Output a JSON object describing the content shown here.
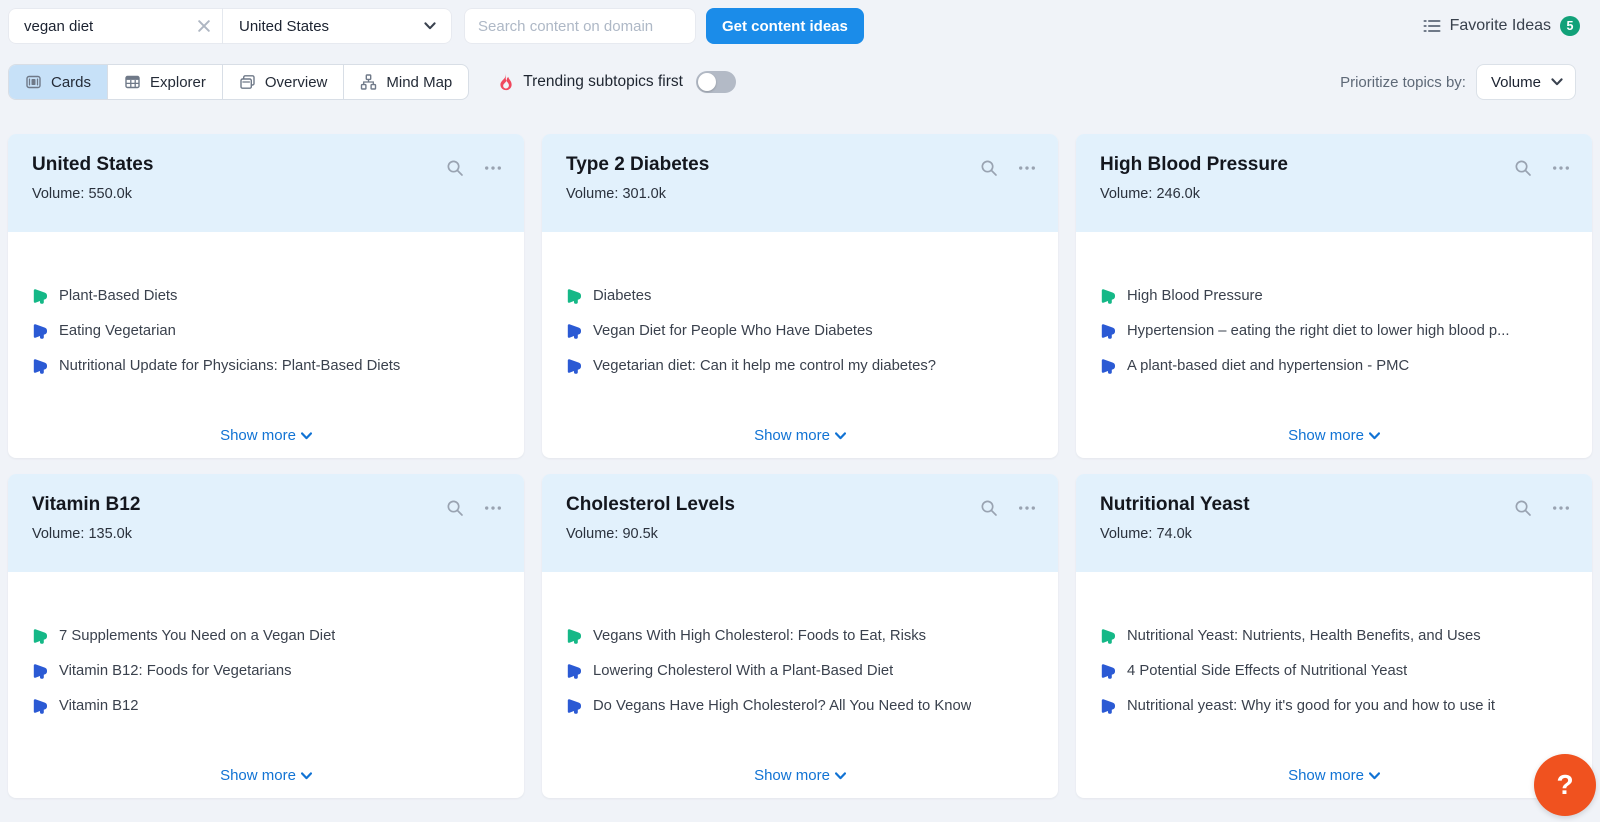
{
  "topbar": {
    "query": {
      "value": "vegan diet"
    },
    "region": {
      "value": "United States"
    },
    "domain_search": {
      "placeholder": "Search content on domain"
    },
    "cta": {
      "label": "Get content ideas"
    },
    "favorites": {
      "label": "Favorite Ideas",
      "count": "5"
    }
  },
  "viewbar": {
    "tabs": [
      {
        "label": "Cards",
        "selected": true
      },
      {
        "label": "Explorer",
        "selected": false
      },
      {
        "label": "Overview",
        "selected": false
      },
      {
        "label": "Mind Map",
        "selected": false
      }
    ],
    "trending_toggle": {
      "label": "Trending subtopics first",
      "state": "off"
    },
    "prioritize": {
      "label": "Prioritize topics by:",
      "value": "Volume"
    }
  },
  "labels": {
    "volume": "Volume:",
    "show_more": "Show more"
  },
  "cards": [
    {
      "title": "United States",
      "volume": "550.0k",
      "items": [
        {
          "icon": "megaphone-green",
          "text": "Plant-Based Diets"
        },
        {
          "icon": "megaphone-blue",
          "text": "Eating Vegetarian"
        },
        {
          "icon": "megaphone-blue",
          "text": "Nutritional Update for Physicians: Plant-Based Diets"
        }
      ]
    },
    {
      "title": "Type 2 Diabetes",
      "volume": "301.0k",
      "items": [
        {
          "icon": "megaphone-green",
          "text": "Diabetes"
        },
        {
          "icon": "megaphone-blue",
          "text": "Vegan Diet for People Who Have Diabetes"
        },
        {
          "icon": "megaphone-blue",
          "text": "Vegetarian diet: Can it help me control my diabetes?"
        }
      ]
    },
    {
      "title": "High Blood Pressure",
      "volume": "246.0k",
      "items": [
        {
          "icon": "megaphone-green",
          "text": "High Blood Pressure"
        },
        {
          "icon": "megaphone-blue",
          "text": "Hypertension – eating the right diet to lower high blood p..."
        },
        {
          "icon": "megaphone-blue",
          "text": "A plant-based diet and hypertension - PMC"
        }
      ]
    },
    {
      "title": "Vitamin B12",
      "volume": "135.0k",
      "items": [
        {
          "icon": "megaphone-green",
          "text": "7 Supplements You Need on a Vegan Diet"
        },
        {
          "icon": "megaphone-blue",
          "text": "Vitamin B12: Foods for Vegetarians"
        },
        {
          "icon": "megaphone-blue",
          "text": "Vitamin B12"
        }
      ]
    },
    {
      "title": "Cholesterol Levels",
      "volume": "90.5k",
      "items": [
        {
          "icon": "megaphone-green",
          "text": "Vegans With High Cholesterol: Foods to Eat, Risks"
        },
        {
          "icon": "megaphone-blue",
          "text": "Lowering Cholesterol With a Plant-Based Diet"
        },
        {
          "icon": "megaphone-blue",
          "text": "Do Vegans Have High Cholesterol? All You Need to Know"
        }
      ]
    },
    {
      "title": "Nutritional Yeast",
      "volume": "74.0k",
      "items": [
        {
          "icon": "megaphone-green",
          "text": "Nutritional Yeast: Nutrients, Health Benefits, and Uses"
        },
        {
          "icon": "megaphone-blue",
          "text": "4 Potential Side Effects of Nutritional Yeast"
        },
        {
          "icon": "megaphone-blue",
          "text": "Nutritional yeast: Why it's good for you and how to use it"
        }
      ]
    }
  ],
  "help_button": {
    "label": "?"
  },
  "colors": {
    "primary_blue": "#1b8ce9",
    "link_blue": "#1173d4",
    "badge_green": "#12a179",
    "megaphone_green": "#15b887",
    "megaphone_blue": "#2b5ad4",
    "flame_red": "#f0475d",
    "help_orange": "#f0521f",
    "card_header_blue": "#e2f1fc",
    "selected_tab_blue": "#c7e1f8",
    "page_background": "#f0f3f8"
  }
}
